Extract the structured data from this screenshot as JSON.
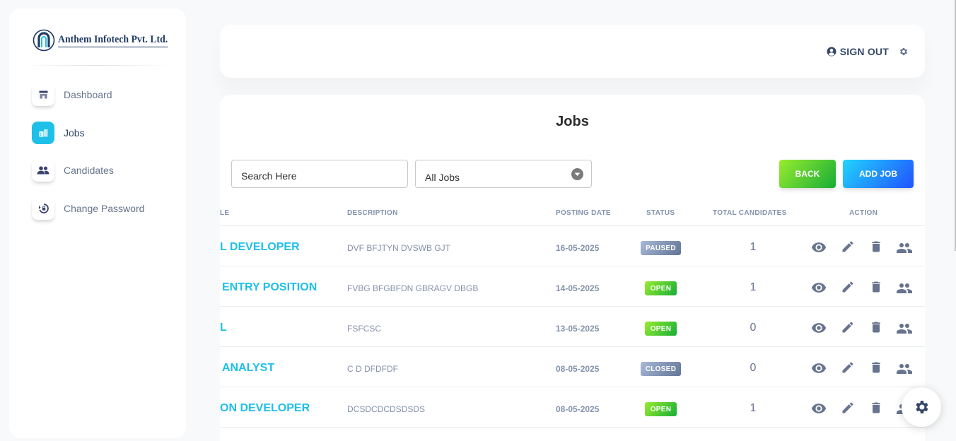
{
  "brand": {
    "name": "Anthem Infotech Pvt. Ltd."
  },
  "nav": [
    {
      "label": "Dashboard",
      "icon": "shop-icon",
      "active": false
    },
    {
      "label": "Jobs",
      "icon": "office-icon",
      "active": true
    },
    {
      "label": "Candidates",
      "icon": "people-icon",
      "active": false
    },
    {
      "label": "Change Password",
      "icon": "lock-reset-icon",
      "active": false
    }
  ],
  "header": {
    "signout_label": "SIGN OUT"
  },
  "jobs": {
    "title": "Jobs",
    "search_placeholder": "Search Here",
    "filter_value": "All Jobs",
    "back_label": "BACK",
    "add_label": "ADD JOB",
    "columns": {
      "title": "LE",
      "description": "DESCRIPTION",
      "posting_date": "POSTING DATE",
      "status": "STATUS",
      "total_candidates": "TOTAL CANDIDATES",
      "action": "ACTION"
    },
    "rows": [
      {
        "title": "L DEVELOPER",
        "description": "DVF BFJTYN DVSWB GJT",
        "date": "16-05-2025",
        "status": "PAUSED",
        "count": "1"
      },
      {
        "title": " ENTRY POSITION",
        "description": "FVBG BFGBFDN GBRAGV DBGB",
        "date": "14-05-2025",
        "status": "OPEN",
        "count": "1"
      },
      {
        "title": "L",
        "description": "FSFCSC",
        "date": "13-05-2025",
        "status": "OPEN",
        "count": "0"
      },
      {
        "title": " ANALYST",
        "description": "C D DFDFDF",
        "date": "08-05-2025",
        "status": "CLOSED",
        "count": "0"
      },
      {
        "title": "ON DEVELOPER",
        "description": "DCSDCDCDSDSDS",
        "date": "08-05-2025",
        "status": "OPEN",
        "count": "1"
      }
    ]
  },
  "colors": {
    "accent": "#1ec0e8",
    "open": "#17ad37",
    "paused": "#627594",
    "text": "#344767"
  }
}
